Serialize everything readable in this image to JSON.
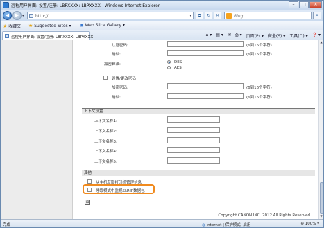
{
  "window": {
    "title": "远程用户界面: 设置/注册: LBPXXXX: LBPXXXX - Windows Internet Explorer",
    "minimize": "–",
    "maximize": "□",
    "close": "✕"
  },
  "address": {
    "url": "http://",
    "search_placeholder": "Bing",
    "back_glyph": "◀",
    "fwd_glyph": "▶"
  },
  "favorites": {
    "label": "收藏夹",
    "items": [
      "Suggested Sites ▾",
      "Web Slice Gallery ▾"
    ]
  },
  "tab": {
    "label": "远程用户界面: 设置/注册: LBPXXXX: LBPXXXX"
  },
  "commands": [
    "页面(P) ▾",
    "安全(S) ▾",
    "工具(O) ▾",
    "❓ ▾"
  ],
  "form": {
    "auth_password_label": "认证密码:",
    "confirm_label": "确认:",
    "hint": "(6到16个字符)",
    "encryption_label": "加密算法:",
    "des": "DES",
    "aes": "AES",
    "set_change_password": "设置/更改密码",
    "encryption_password_label": "加密密码:",
    "confirm2_label": "确认:",
    "context_section": "上下文设置",
    "context_names": [
      "上下文名称1:",
      "上下文名称2:",
      "上下文名称3:",
      "上下文名称4:",
      "上下文名称5:"
    ],
    "other_section": "其他",
    "opt_get_printer_mgmt": "从主机获取打印机管理信息",
    "opt_snmp_dedicated": "睡眠模式中监视SNMP数据包",
    "submit_glyph": "⊞",
    "copyright": "Copyright CANON INC. 2012 All Rights Reserved"
  },
  "status": {
    "left": "完成",
    "zone": "Internet | 保护模式: 启用",
    "zoom": "100% ▾"
  }
}
